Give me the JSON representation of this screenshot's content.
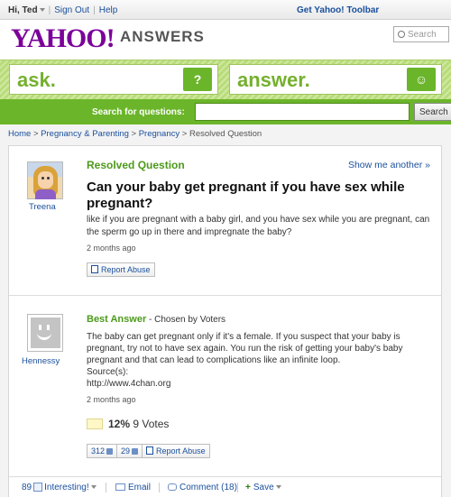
{
  "topbar": {
    "greeting": "Hi, Ted",
    "sign_out": "Sign Out",
    "help": "Help",
    "toolbar_link": "Get Yahoo! Toolbar"
  },
  "header": {
    "logo": "YAHOO!",
    "section": "ANSWERS",
    "search_placeholder": "Search"
  },
  "ask_answer": {
    "ask_label": "ask.",
    "ask_icon": "?",
    "answer_label": "answer.",
    "answer_icon": "☺"
  },
  "questions_search": {
    "label": "Search for questions:",
    "value": "",
    "button": "Search"
  },
  "breadcrumb": {
    "home": "Home",
    "cat1": "Pregnancy & Parenting",
    "cat2": "Pregnancy",
    "current": "Resolved Question"
  },
  "question": {
    "status": "Resolved Question",
    "show_more": "Show me another »",
    "asker": "Treena",
    "title": "Can your baby get pregnant if you have sex while pregnant?",
    "body": "like if you are pregnant with a baby girl, and you have sex while you are pregnant, can the sperm go up in there and impregnate the baby?",
    "time": "2 months ago",
    "report": "Report Abuse"
  },
  "best_answer": {
    "label": "Best Answer",
    "chosen_by": " - Chosen by Voters",
    "answerer": "Hennessy",
    "body": "The baby can get pregnant only if it's a female. If you suspect that your baby is pregnant, try not to have sex again. You run the risk of getting your baby's baby pregnant and that can lead to complications like an infinite loop.",
    "source_label": "Source(s):",
    "source": "http://www.4chan.org",
    "time": "2 months ago",
    "vote_percent": "12%",
    "vote_count": "9 Votes",
    "thumbs_up": "312",
    "thumbs_down": "29",
    "report": "Report Abuse"
  },
  "footer": {
    "interesting_count": "89",
    "interesting": "Interesting!",
    "email": "Email",
    "comment": "Comment (18)",
    "save": "Save"
  },
  "colors": {
    "brand_purple": "#7b0099",
    "accent_green": "#6bb52a",
    "link_blue": "#1a4f9c"
  }
}
